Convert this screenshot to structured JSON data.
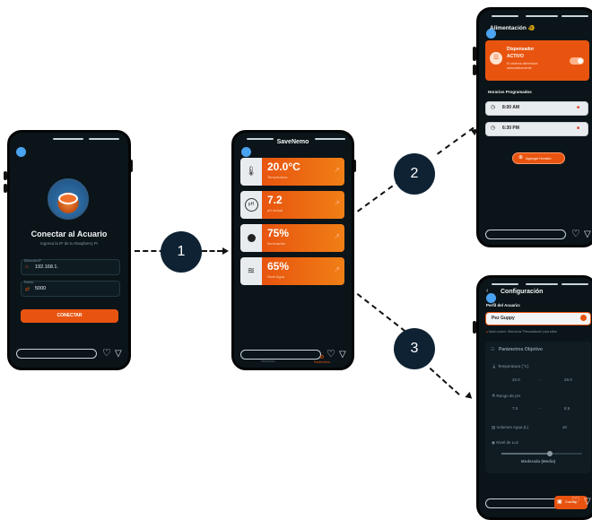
{
  "steps": {
    "one": "1",
    "two": "2",
    "three": "3"
  },
  "login": {
    "title": "Conectar al Acuario",
    "subtitle": "Ingresa la IP de tu Raspberry Pi",
    "ip_label": "Dirección IP",
    "ip_value": "192.168.1.",
    "port_label": "Puerto",
    "port_value": "5000",
    "connect_button": "CONECTAR"
  },
  "dashboard": {
    "title": "SaveNemo",
    "cards": [
      {
        "value": "20.0°C",
        "label": "Temperatura",
        "icon": "thermometer-icon"
      },
      {
        "value": "7.2",
        "label": "pH Actual",
        "icon": "ph-icon"
      },
      {
        "value": "75%",
        "label": "Iluminación",
        "icon": "bulb-icon"
      },
      {
        "value": "65%",
        "label": "Nivel Agua",
        "icon": "water-icon"
      }
    ],
    "tabs": [
      "Monitoreo",
      "Parámetros"
    ]
  },
  "feeding": {
    "title": "Alimentación 🐠",
    "dispenser_title": "Dispensador",
    "dispenser_status": "ACTIVO",
    "dispenser_note": "El sistema alimentará automáticamente",
    "schedule_heading": "Horarios Programados",
    "times": [
      "8:00 AM",
      "6:30 PM"
    ],
    "add_button": "Agregar Horario"
  },
  "config": {
    "title": "Configuración",
    "profile_label": "Perfil del Acuario:",
    "profile_value": "Pez Guppy",
    "profile_hint": "Modo custom: Selecciona \"Personalizado\" para editar",
    "params_heading": "Parámetros Objetivo",
    "temp_label": "Temperatura (°C)",
    "temp_min": "22.0",
    "temp_sep": "-",
    "temp_max": "26.0",
    "ph_label": "Rango de pH",
    "ph_min": "7.0",
    "ph_sep": "-",
    "ph_max": "8.5",
    "volume_label": "Volumen Agua (L)",
    "volume_value": "40",
    "light_label": "Nivel de Luz",
    "light_level": 0.6,
    "light_value": "Moderada (Media)",
    "save_button": "Guardar"
  },
  "colors": {
    "accent": "#e8540f",
    "screen": "#0a1419",
    "dot": "#4aa3f0"
  }
}
